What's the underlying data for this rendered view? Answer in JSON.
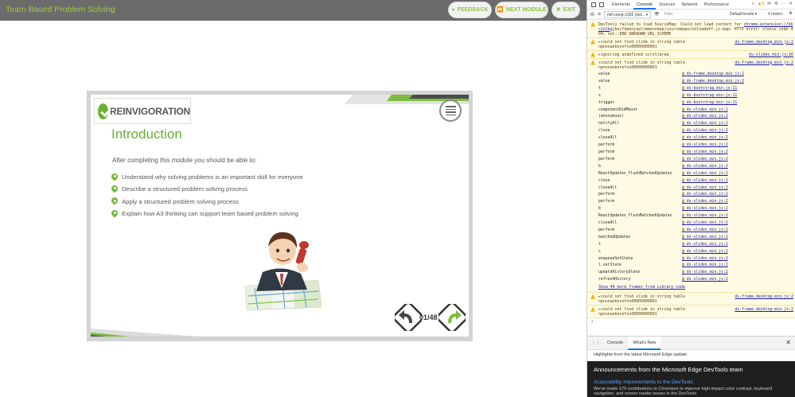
{
  "app": {
    "title": "Team Based Problem Solving",
    "buttons": {
      "feedback": "FEEDBACK",
      "next_module": "NEXT MODULE",
      "exit": "EXIT"
    },
    "brand_color": "#8ac53f"
  },
  "slide": {
    "logo_text": "REINVIGORATION",
    "heading": "Introduction",
    "intro": "After completing this module you should be able to:",
    "bullets": [
      "Understand why solving problems is an important skill for everyone",
      "Describe a structured problem solving process",
      "Apply a structured problem solving process",
      "Explain how A3 thinking can support team based problem solving"
    ],
    "counter": "01/48"
  },
  "devtools": {
    "tabs": [
      "Elements",
      "Console",
      "Sources",
      "Network",
      "Performance"
    ],
    "active_tab": "Console",
    "warnings_count": "5",
    "context": "mif-comp-1002 (ind...",
    "filter_placeholder": "Filter",
    "levels": "Default levels",
    "hidden": "4 hidden",
    "messages": [
      {
        "text": "DevTools failed to load SourceMap: Could not load content for ",
        "link": "chrome-extension://bbcinlkg",
        "tail": "jbeifdpenjaalimmonokmp/sourcemaps/onloadwff.js.map: HTTP error: status code 404, net::ERR_UNKNOWN_URL_SCHEME",
        "src": ""
      },
      {
        "text": "▸could not find slide in string table\nnpnxnanbnsnfns00000000001",
        "src": "ds-frame.desktop.min.js:2"
      },
      {
        "text": "▸ignoring undefined scrollarea",
        "src": "ds-slides.min.js:16"
      },
      {
        "text": "▾could not find slide in string table\nnpnxnanbnsnfns00000000001",
        "src": "ds-frame.desktop.min.js:2"
      }
    ],
    "frames": [
      {
        "fn": "value",
        "at": "ds-frame.desktop.min.js:2"
      },
      {
        "fn": "value",
        "at": "ds-frame.desktop.min.js:2"
      },
      {
        "fn": "t",
        "at": "ds-bootstrap.min.js:11"
      },
      {
        "fn": "s",
        "at": "ds-bootstrap.min.js:11"
      },
      {
        "fn": "trigger",
        "at": "ds-bootstrap.min.js:11"
      },
      {
        "fn": "componentDidMount",
        "at": "ds-slides.min.js:2"
      },
      {
        "fn": "(anonymous)",
        "at": "ds-slides.min.js:2"
      },
      {
        "fn": "notifyAll",
        "at": "ds-slides.min.js:2"
      },
      {
        "fn": "close",
        "at": "ds-slides.min.js:2"
      },
      {
        "fn": "closeAll",
        "at": "ds-slides.min.js:2"
      },
      {
        "fn": "perform",
        "at": "ds-slides.min.js:2"
      },
      {
        "fn": "perform",
        "at": "ds-slides.min.js:2"
      },
      {
        "fn": "perform",
        "at": "ds-slides.min.js:2"
      },
      {
        "fn": "b",
        "at": "ds-slides.min.js:2"
      },
      {
        "fn": "ReactUpdates_flushBatchedUpdates",
        "at": "ds-slides.min.js:2"
      },
      {
        "fn": "close",
        "at": "ds-slides.min.js:2"
      },
      {
        "fn": "closeAll",
        "at": "ds-slides.min.js:2"
      },
      {
        "fn": "perform",
        "at": "ds-slides.min.js:2"
      },
      {
        "fn": "perform",
        "at": "ds-slides.min.js:2"
      },
      {
        "fn": "b",
        "at": "ds-slides.min.js:2"
      },
      {
        "fn": "ReactUpdates_flushBatchedUpdates",
        "at": "ds-slides.min.js:2"
      },
      {
        "fn": "closeAll",
        "at": "ds-slides.min.js:2"
      },
      {
        "fn": "perform",
        "at": "ds-slides.min.js:2"
      },
      {
        "fn": "batchedUpdates",
        "at": "ds-slides.min.js:2"
      },
      {
        "fn": "t",
        "at": "ds-slides.min.js:2"
      },
      {
        "fn": "c",
        "at": "ds-slides.min.js:2"
      },
      {
        "fn": "enqueueSetState",
        "at": "ds-slides.min.js:2"
      },
      {
        "fn": "l.setState",
        "at": "ds-slides.min.js:2"
      },
      {
        "fn": "updateHistoryState",
        "at": "ds-slides.min.js:2"
      },
      {
        "fn": "refreshHistory",
        "at": "ds-slides.min.js:2"
      }
    ],
    "more_frames": "Show 44 more frames from Library code",
    "tail_messages": [
      {
        "text": "▸could not find slide in string table\nnpnxnanbnsnfns00000000001",
        "src": "ds-frame.desktop.min.js:2"
      },
      {
        "text": "▸could not find slide in string table\nnpnxnanbnsnfns00000000001",
        "src": "ds-frame.desktop.min.js:2"
      }
    ],
    "prompt": "›",
    "drawer": {
      "tabs": [
        "Console",
        "What's New"
      ],
      "active": "What's New",
      "subtitle": "Highlights from the latest Microsoft Edge update",
      "title": "Announcements from the Microsoft Edge DevTools team",
      "link": "Accessibility improvements to the DevTools",
      "text": "We've made 170 contributions to Chromium to improve high-impact color contrast, keyboard navigation, and screen reader issues in the DevTools."
    }
  }
}
